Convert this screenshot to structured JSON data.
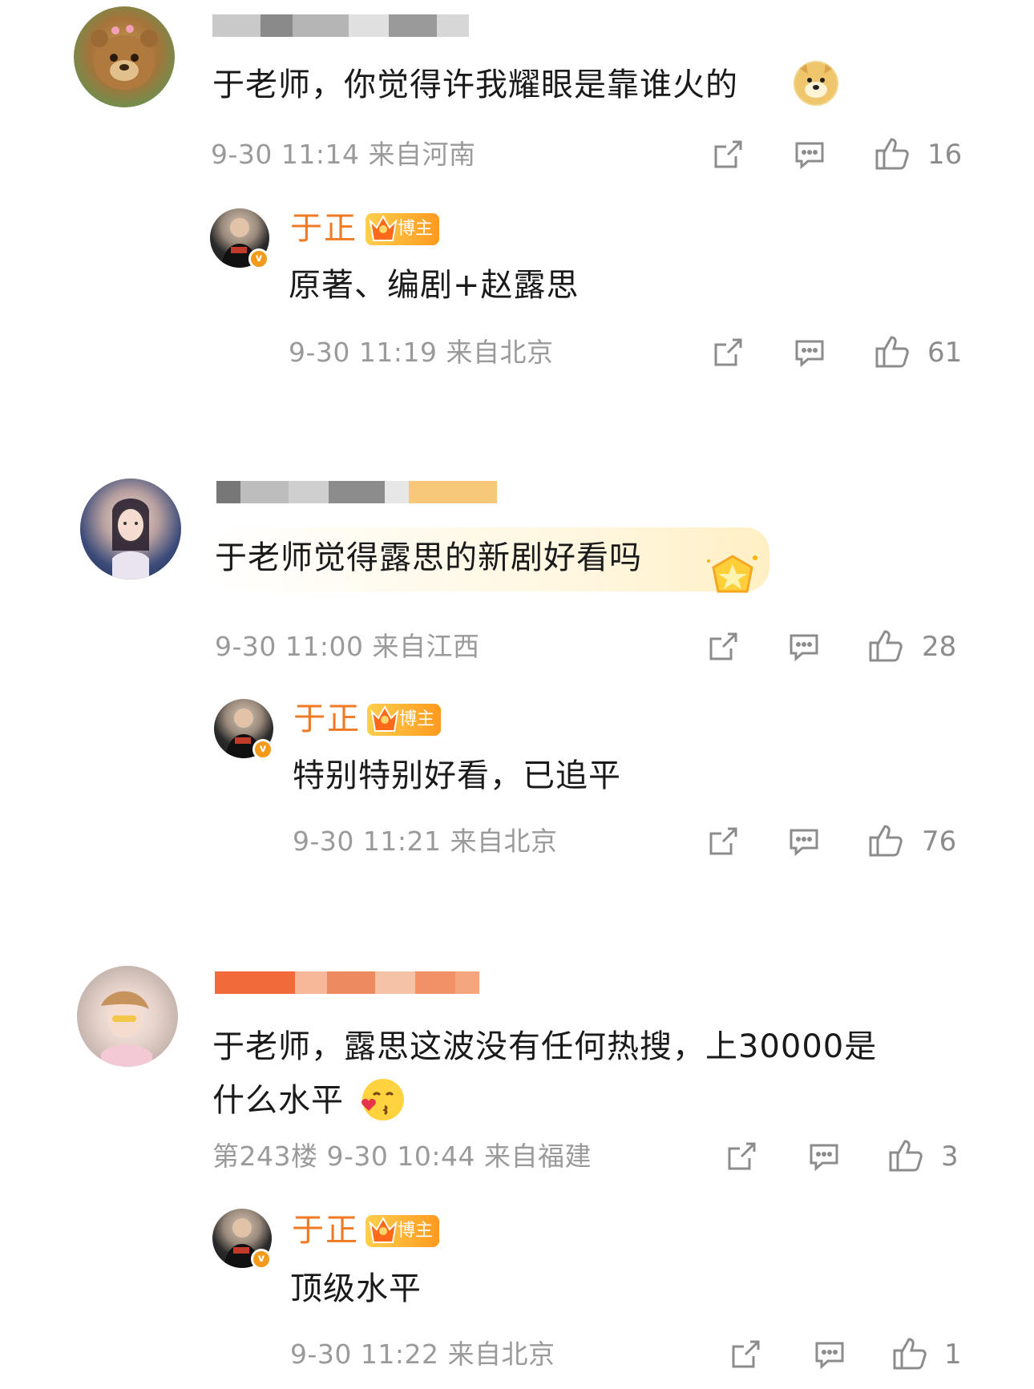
{
  "comments": [
    {
      "text": "于老师，你觉得许我耀眼是靠谁火的",
      "emoji_icon": "doge-icon",
      "meta": "9-30 11:14  来自河南",
      "likes": "16",
      "reply": {
        "name": "于正",
        "badge": "博主",
        "text": "原著、编剧+赵露思",
        "meta": "9-30 11:19  来自北京",
        "likes": "61"
      }
    },
    {
      "text": "于老师觉得露思的新剧好看吗",
      "emoji_icon": "star-badge-icon",
      "meta": "9-30 11:00  来自江西",
      "likes": "28",
      "reply": {
        "name": "于正",
        "badge": "博主",
        "text": "特别特别好看，已追平",
        "meta": "9-30 11:21  来自北京",
        "likes": "76"
      }
    },
    {
      "text_line1": "于老师，露思这波没有任何热搜，上30000是",
      "text_line2": "什么水平",
      "emoji_icon": "kiss-emoji-icon",
      "meta": "第243楼 9-30 10:44  来自福建",
      "likes": "3",
      "reply": {
        "name": "于正",
        "badge": "博主",
        "text": "顶级水平",
        "meta": "9-30 11:22  来自北京",
        "likes": "1"
      }
    }
  ],
  "colors": {
    "accent": "#f07a24",
    "meta": "#9a9a9a",
    "icon": "#8c8c8c"
  }
}
